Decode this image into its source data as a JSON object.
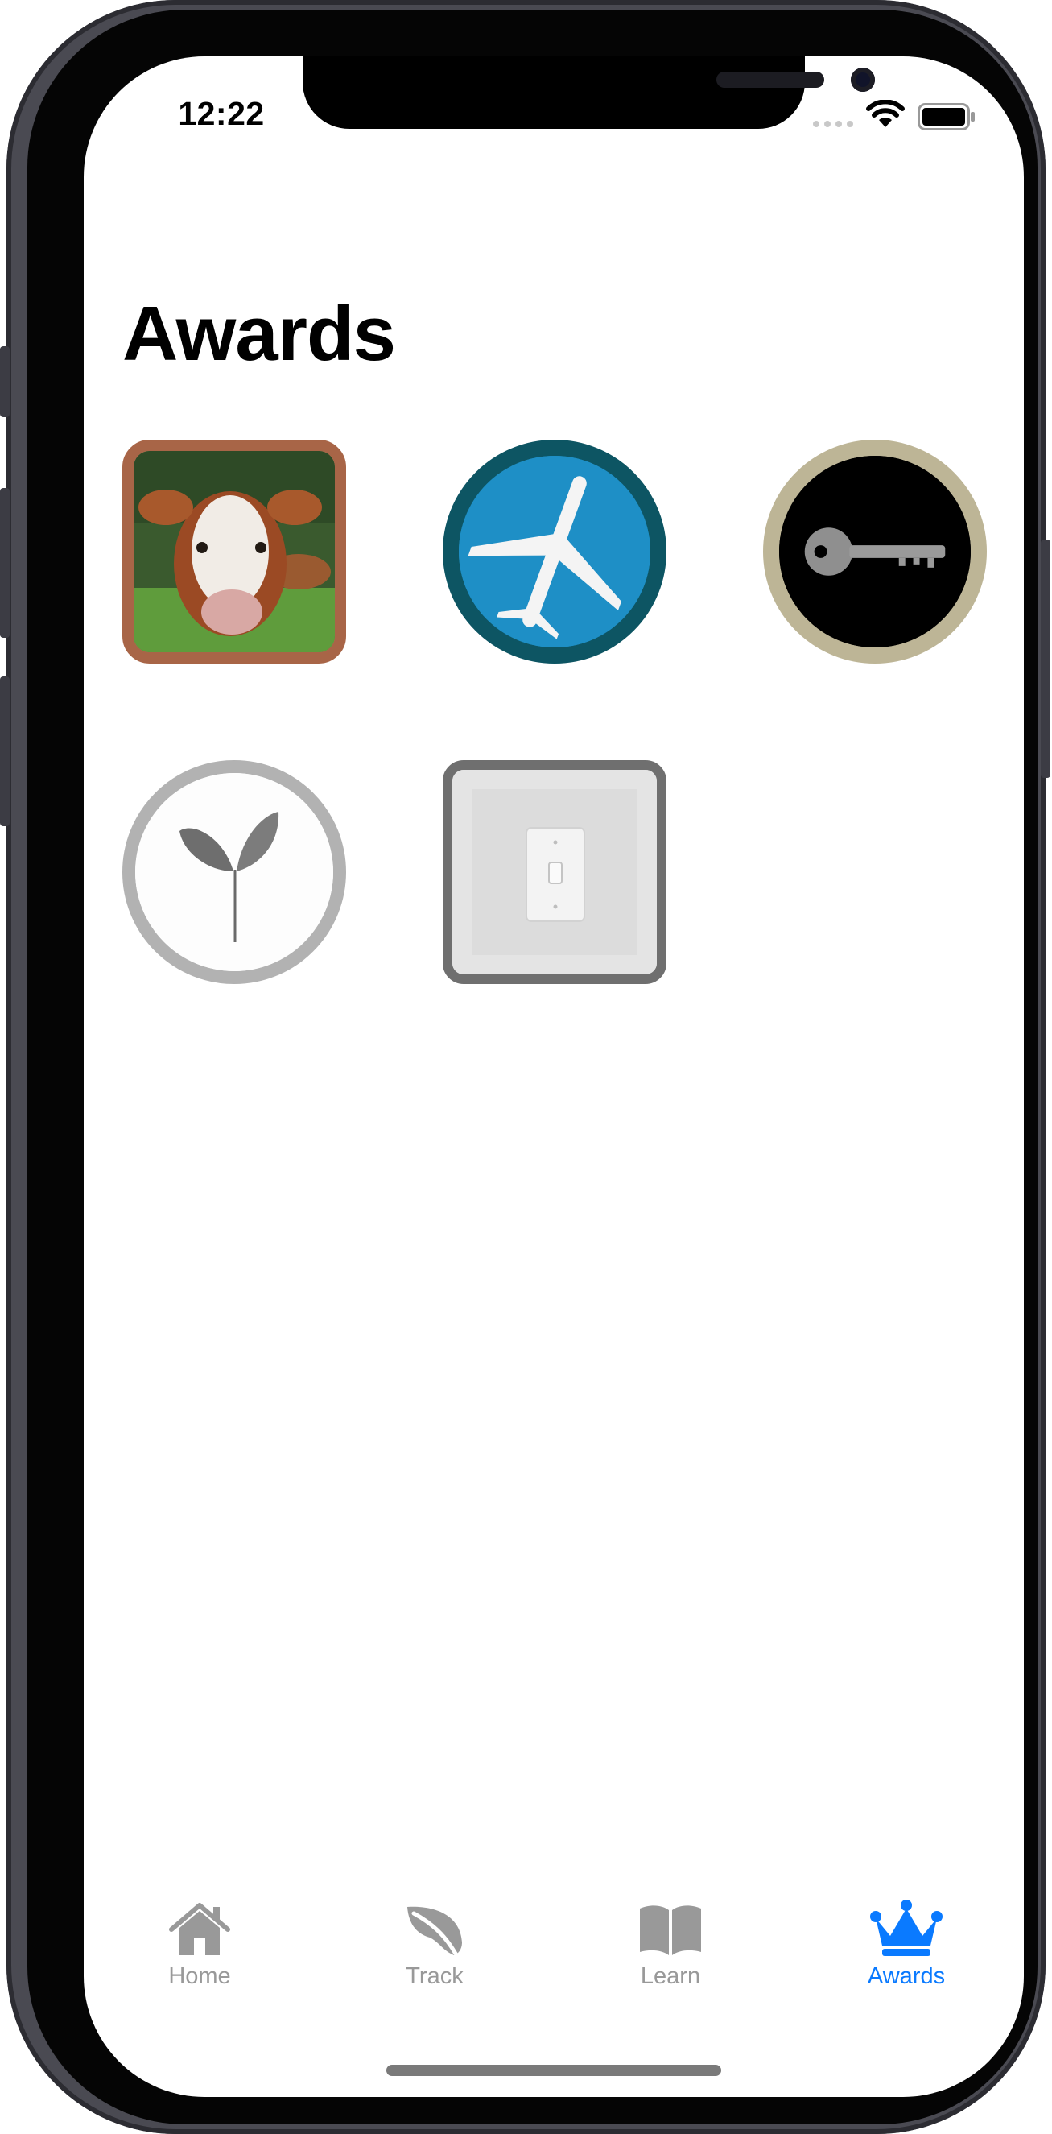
{
  "status_bar": {
    "time": "12:22"
  },
  "page": {
    "title": "Awards"
  },
  "awards": [
    {
      "name": "cow-award-icon"
    },
    {
      "name": "airplane-award-icon"
    },
    {
      "name": "key-award-icon"
    },
    {
      "name": "sprout-award-icon"
    },
    {
      "name": "light-switch-award-icon"
    }
  ],
  "tab_bar": {
    "items": [
      {
        "label": "Home",
        "icon": "house-icon",
        "active": false
      },
      {
        "label": "Track",
        "icon": "leaf-icon",
        "active": false
      },
      {
        "label": "Learn",
        "icon": "book-icon",
        "active": false
      },
      {
        "label": "Awards",
        "icon": "crown-icon",
        "active": true
      }
    ],
    "active_color": "#0a7aff",
    "inactive_color": "#999999"
  }
}
